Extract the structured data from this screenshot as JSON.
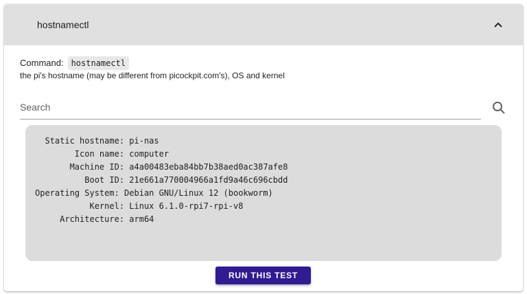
{
  "panel": {
    "title": "hostnamectl",
    "collapse_icon": "chevron-up-icon"
  },
  "command": {
    "label": "Command:",
    "code": "hostnamectl",
    "description": "the pi's hostname (may be different from picockpit.com's), OS and kernel"
  },
  "search": {
    "placeholder": "Search",
    "value": "",
    "icon": "search-icon"
  },
  "output": {
    "text": "  Static hostname: pi-nas\n        Icon name: computer\n       Machine ID: a4a00483eba84bb7b38aed0ac387afe8\n          Boot ID: 21e661a770004966a1fd9a46c696cbdd\nOperating System: Debian GNU/Linux 12 (bookworm)\n           Kernel: Linux 6.1.0-rpi7-rpi-v8\n     Architecture: arm64"
  },
  "actions": {
    "run_label": "RUN THIS TEST"
  },
  "colors": {
    "accent": "#311b92",
    "header_bg": "#e0e0e0",
    "output_bg": "#dcdcdc"
  }
}
